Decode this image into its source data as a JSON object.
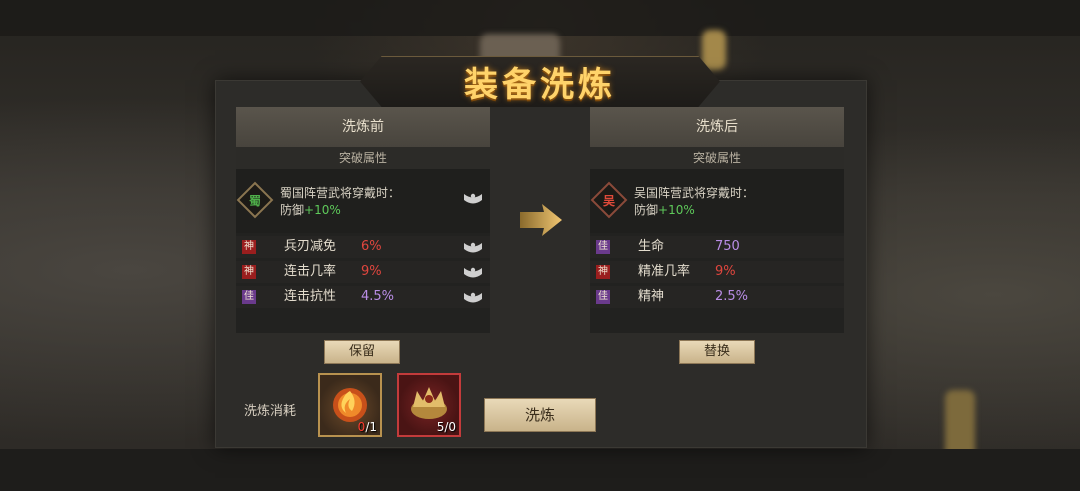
{
  "title": "装备洗炼",
  "before": {
    "header": "洗炼前",
    "section_label": "突破属性",
    "faction": {
      "char": "蜀",
      "line1": "蜀国阵营武将穿戴时：",
      "line2_prefix": "防御",
      "line2_value": "+10%"
    },
    "stats": [
      {
        "tag": "神",
        "name": "兵刃减免",
        "value": "6%"
      },
      {
        "tag": "神",
        "name": "连击几率",
        "value": "9%"
      },
      {
        "tag": "佳",
        "name": "连击抗性",
        "value": "4.5%"
      }
    ],
    "button": "保留"
  },
  "after": {
    "header": "洗炼后",
    "section_label": "突破属性",
    "faction": {
      "char": "吴",
      "line1": "吴国阵营武将穿戴时：",
      "line2_prefix": "防御",
      "line2_value": "+10%"
    },
    "stats": [
      {
        "tag": "佳",
        "name": "生命",
        "value": "750"
      },
      {
        "tag": "神",
        "name": "精准几率",
        "value": "9%"
      },
      {
        "tag": "佳",
        "name": "精神",
        "value": "2.5%"
      }
    ],
    "button": "替换"
  },
  "cost": {
    "label": "洗炼消耗",
    "items": [
      {
        "icon": "fire-orb-icon",
        "count_have": "0",
        "count_sep_total": "/1"
      },
      {
        "icon": "golden-crown-icon",
        "count_text": "5/0"
      }
    ]
  },
  "refine_button": "洗炼",
  "colors": {
    "title_gold": "#ffd36a",
    "god_red": "#9a1e1e",
    "good_purple": "#6a3a8c",
    "bonus_green": "#5ec95a"
  }
}
